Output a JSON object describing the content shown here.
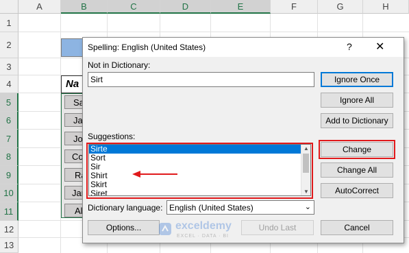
{
  "columns": [
    "A",
    "B",
    "C",
    "D",
    "E",
    "F",
    "G",
    "H"
  ],
  "rows": [
    "1",
    "2",
    "3",
    "4",
    "5",
    "6",
    "7",
    "8",
    "9",
    "10",
    "11",
    "12",
    "13"
  ],
  "sheet": {
    "header_partial": "Na",
    "names_partial": [
      "Sa",
      "Ja",
      "Jo",
      "Co",
      "Ra",
      "Jar",
      "Al"
    ]
  },
  "dialog": {
    "title": "Spelling: English (United States)",
    "help": "?",
    "close": "✕",
    "not_in_dict_label": "Not in Dictionary:",
    "not_in_dict_value": "Sirt",
    "suggestions_label": "Suggestions:",
    "suggestions": [
      "Sirte",
      "Sort",
      "Sir",
      "Shirt",
      "Skirt",
      "Siret"
    ],
    "dict_lang_label": "Dictionary language:",
    "dict_lang_value": "English (United States)",
    "buttons": {
      "ignore_once": "Ignore Once",
      "ignore_all": "Ignore All",
      "add_to_dictionary": "Add to Dictionary",
      "change": "Change",
      "change_all": "Change All",
      "autocorrect": "AutoCorrect",
      "options": "Options...",
      "undo_last": "Undo Last",
      "cancel": "Cancel"
    }
  },
  "watermark": {
    "brand": "exceldemy",
    "tagline": "EXCEL · DATA · BI"
  },
  "colors": {
    "excel_green": "#217346",
    "highlight_red": "#e0191b",
    "accent_blue": "#0078d7",
    "header_fill": "#8db4e2"
  }
}
